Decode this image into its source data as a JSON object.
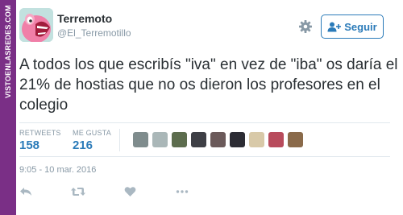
{
  "watermark": {
    "text": "VISTOENLASREDES.COM"
  },
  "header": {
    "display_name": "Terremoto",
    "username": "@El_Terremotillo",
    "follow_label": "Seguir"
  },
  "tweet": {
    "text": "A todos los que escribís \"iva\" en vez de \"iba\" os daría el 21% de hostias que no os dieron los profesores en el colegio",
    "timestamp": "9:05 - 10 mar. 2016"
  },
  "stats": {
    "retweets_label": "RETWEETS",
    "retweets_value": "158",
    "likes_label": "ME GUSTA",
    "likes_value": "216"
  },
  "liker_avatars": [
    "#7f8c8d",
    "#aab7b8",
    "#5d6d4e",
    "#3e3f45",
    "#6b5a5a",
    "#2c2c34",
    "#d8c9a8",
    "#b84b5c",
    "#8a6a4a"
  ],
  "icons": {
    "avatar": "pink-monster-avatar",
    "settings": "gear-icon",
    "follow": "add-user-icon",
    "reply": "reply-icon",
    "retweet": "retweet-icon",
    "like": "heart-icon",
    "more": "more-icon"
  },
  "colors": {
    "accent": "#2b7bb9",
    "text": "#292f33",
    "muted": "#8899a6",
    "watermark": "#7a2f86"
  }
}
